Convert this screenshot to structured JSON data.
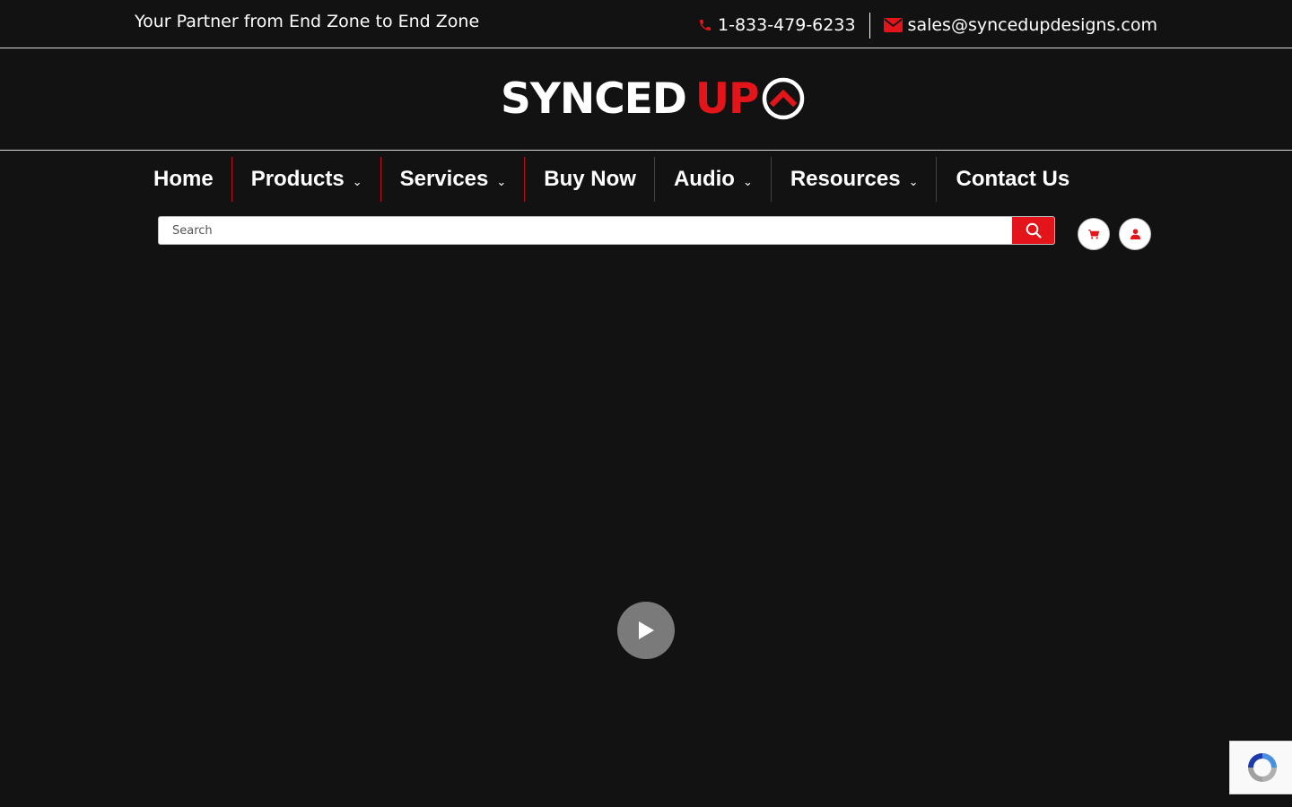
{
  "topbar": {
    "tagline": "Your Partner from End Zone to End Zone",
    "phone": "1-833-479-6233",
    "email": "sales@syncedupdesigns.com"
  },
  "logo": {
    "word_white": "SYNCED",
    "word_red": "UP"
  },
  "nav": {
    "items": [
      {
        "label": "Home",
        "has_dropdown": false
      },
      {
        "label": "Products",
        "has_dropdown": true
      },
      {
        "label": "Services",
        "has_dropdown": true
      },
      {
        "label": "Buy Now",
        "has_dropdown": false
      },
      {
        "label": "Audio",
        "has_dropdown": true
      },
      {
        "label": "Resources",
        "has_dropdown": true
      },
      {
        "label": "Contact Us",
        "has_dropdown": false
      }
    ],
    "caret": "⌄"
  },
  "search": {
    "placeholder": "Search",
    "value": ""
  },
  "icons": {
    "phone": "phone-icon",
    "email": "envelope-icon",
    "search": "search-icon",
    "cart": "cart-icon",
    "account": "user-icon",
    "play": "play-icon",
    "recaptcha": "recaptcha-icon"
  },
  "colors": {
    "background": "#121212",
    "accent": "#e3151a",
    "text": "#ffffff",
    "play_button": "#7a7a7a"
  }
}
